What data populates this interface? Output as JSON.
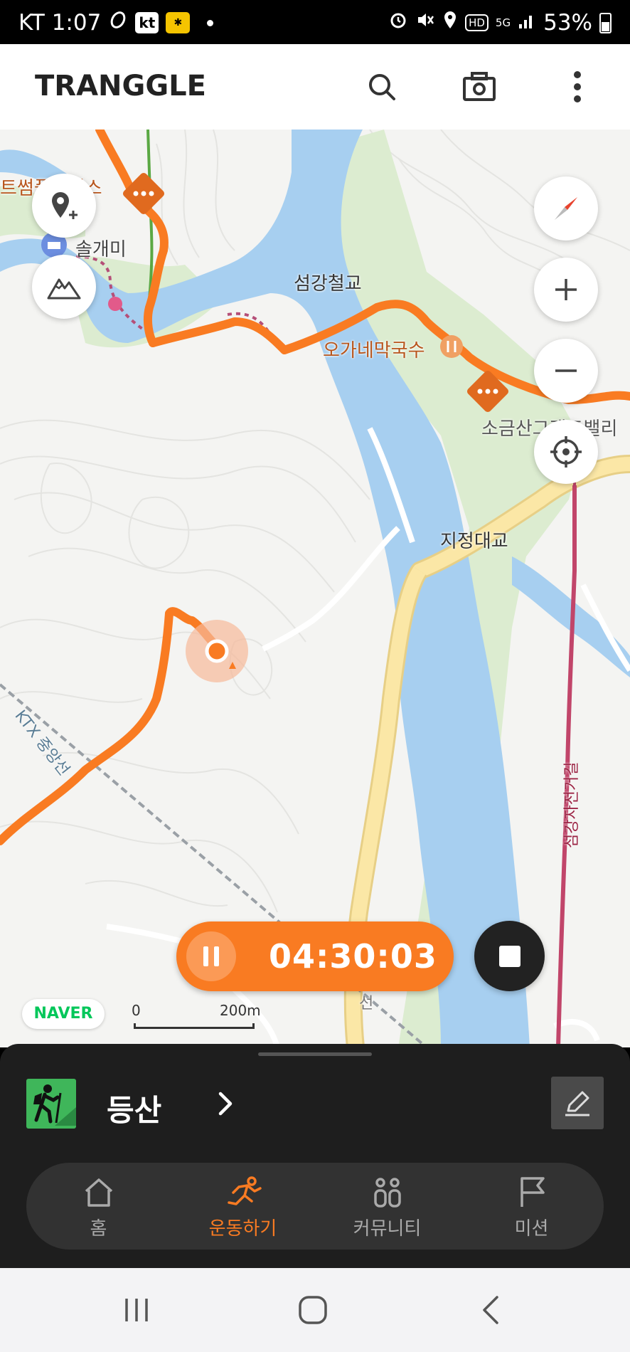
{
  "status_bar": {
    "carrier_time": "KT 1:07",
    "kt_badge": "kt",
    "battery": "53%",
    "network": "5G",
    "hd": "HD"
  },
  "header": {
    "logo": "TRANGGLE"
  },
  "map": {
    "labels": {
      "poi_top_left": "트썸플레이스",
      "solgaemi": "솔개미",
      "seomgang_bridge": "섬강철교",
      "restaurant": "오가네막국수",
      "sogeumsan": "소금산그랜드밸리",
      "jijeong_bridge": "지정대교",
      "rail": "KTX 중앙선",
      "bike_path": "섬강자전거길",
      "road_number": "선"
    },
    "naver": "NAVER",
    "scale_zero": "0",
    "scale_distance": "200m"
  },
  "timer": {
    "elapsed": "04:30:03"
  },
  "activity": {
    "label": "등산"
  },
  "tabs": [
    {
      "label": "홈",
      "icon": "home-icon",
      "active": false
    },
    {
      "label": "운동하기",
      "icon": "running-icon",
      "active": true
    },
    {
      "label": "커뮤니티",
      "icon": "community-icon",
      "active": false
    },
    {
      "label": "미션",
      "icon": "flag-icon",
      "active": false
    }
  ],
  "colors": {
    "accent": "#f97b22",
    "track": "#f97b22",
    "water": "#a7cff0",
    "park": "#dcecd0",
    "road": "#fbe7a6",
    "sheet": "#1e1e1e",
    "naver_green": "#03c75a"
  }
}
